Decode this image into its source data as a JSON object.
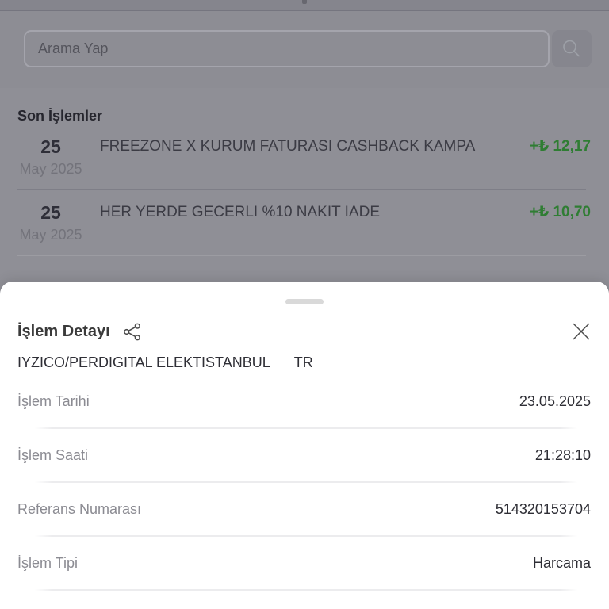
{
  "background": {
    "search": {
      "placeholder": "Arama Yap",
      "icon": "magnifier-icon"
    },
    "section_title": "Son İşlemler",
    "transactions": [
      {
        "day": "25",
        "month_year": "May 2025",
        "title": "FREEZONE X KURUM FATURASI CASHBACK KAMPA",
        "amount": "+₺ 12,17"
      },
      {
        "day": "25",
        "month_year": "May 2025",
        "title": "HER YERDE GECERLI %10 NAKIT IADE",
        "amount": "+₺ 10,70"
      }
    ]
  },
  "sheet": {
    "title": "İşlem Detayı",
    "icons": [
      "share-icon",
      "close-icon",
      "drag-handle"
    ],
    "merchant": {
      "name": "IYZICO/PERDIGITAL ELEKTISTANBUL",
      "country": "TR"
    },
    "rows": [
      {
        "label": "İşlem Tarihi",
        "value": "23.05.2025"
      },
      {
        "label": "İşlem Saati",
        "value": "21:28:10"
      },
      {
        "label": "Referans Numarası",
        "value": "514320153704"
      },
      {
        "label": "İşlem Tipi",
        "value": "Harcama"
      }
    ]
  },
  "colors": {
    "amount_positive_green": "#2f7d33",
    "dim_overlay_gray": "#8f8f96",
    "sheet_background": "#ffffff",
    "divider_light": "#ececee"
  }
}
